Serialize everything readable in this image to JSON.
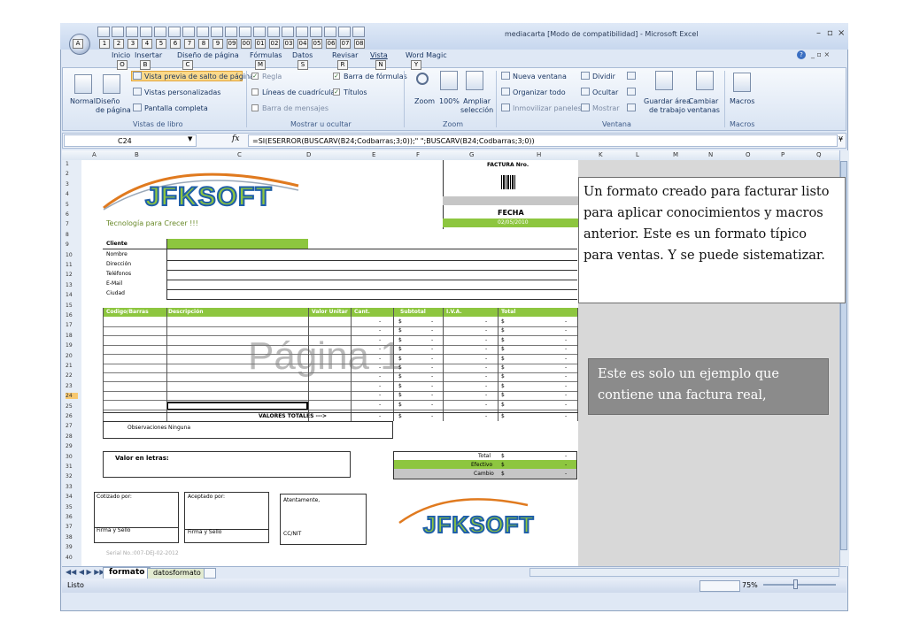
{
  "window": {
    "title": "mediacarta [Modo de compatibilidad] - Microsoft Excel",
    "qat_keytips": [
      "1",
      "2",
      "3",
      "4",
      "5",
      "6",
      "7",
      "8",
      "9",
      "09",
      "00",
      "01",
      "02",
      "03",
      "04",
      "05",
      "06",
      "07",
      "08"
    ],
    "controls": [
      "–",
      "▫",
      "×"
    ]
  },
  "tabs": [
    {
      "label": "Inicio",
      "key": "O"
    },
    {
      "label": "Insertar",
      "key": "B"
    },
    {
      "label": "Diseño de página",
      "key": "C"
    },
    {
      "label": "Fórmulas",
      "key": "M"
    },
    {
      "label": "Datos",
      "key": "S"
    },
    {
      "label": "Revisar",
      "key": "R"
    },
    {
      "label": "Vista",
      "key": "N"
    },
    {
      "label": "Word Magic",
      "key": "Y"
    }
  ],
  "ribbon": {
    "normal": "Normal",
    "diseno": "Diseño\nde página",
    "vista_previa": "Vista previa de salto de página",
    "vistas_personalizadas": "Vistas personalizadas",
    "pantalla_completa": "Pantalla completa",
    "group_vistas": "Vistas de libro",
    "regla": "Regla",
    "barra_formulas": "Barra de fórmulas",
    "lineas": "Líneas de cuadrícula",
    "titulos": "Títulos",
    "barra_mensajes": "Barra de mensajes",
    "group_mostrar": "Mostrar u ocultar",
    "zoom": "Zoom",
    "zoom100": "100%",
    "ampliar": "Ampliar\nselección",
    "group_zoom": "Zoom",
    "nueva_ventana": "Nueva ventana",
    "organizar": "Organizar todo",
    "inmovilizar": "Inmovilizar paneles",
    "dividir": "Dividir",
    "ocultar": "Ocultar",
    "mostrar": "Mostrar",
    "guardar_area": "Guardar área\nde trabajo",
    "cambiar_ventanas": "Cambiar\nventanas",
    "group_ventana": "Ventana",
    "macros": "Macros",
    "group_macros": "Macros"
  },
  "formula_bar": {
    "name_box": "C24",
    "fx": "fx",
    "formula": "=SI(ESERROR(BUSCARV(B24;Codbarras;3;0));\" \";BUSCARV(B24;Codbarras;3;0))"
  },
  "columns": [
    "A",
    "B",
    "C",
    "D",
    "E",
    "F",
    "G",
    "H",
    "K",
    "L",
    "M",
    "N",
    "O",
    "P",
    "Q"
  ],
  "rows": [
    "1",
    "2",
    "3",
    "4",
    "5",
    "6",
    "7",
    "8",
    "9",
    "10",
    "11",
    "12",
    "13",
    "14",
    "15",
    "16",
    "17",
    "18",
    "19",
    "20",
    "21",
    "22",
    "23",
    "24",
    "25",
    "26",
    "27",
    "28",
    "29",
    "30",
    "31",
    "32",
    "33",
    "34",
    "35",
    "36",
    "37",
    "38",
    "39",
    "40"
  ],
  "invoice": {
    "factura": "FACTURA Nro.",
    "fecha": "FECHA",
    "fecha_val": "02/05/2010",
    "logo": "JFKSOFT",
    "tagline": "Tecnología para Crecer !!!",
    "cliente": "Cliente",
    "fields": [
      "Nombre",
      "Dirección",
      "Teléfonos",
      "E-Mail",
      "Ciudad"
    ],
    "headers": [
      "Codigo/Barras",
      "Descripción",
      "Valor Unitar",
      "Cant.",
      "Subtotal",
      "I.V.A.",
      "Total"
    ],
    "dollar": "$",
    "dash": "-",
    "valores_totales": "VALORES TOTALES --->",
    "observaciones": "Observaciones",
    "ninguna": "Ninguna",
    "valor_letras": "Valor en letras:",
    "total": "Total",
    "efectivo": "Efectivo",
    "cambio": "Cambio",
    "cotizado": "Cotizado por:",
    "aceptado": "Aceptado por:",
    "atentamente": "Atentamente,",
    "firma1": "Firma y Sello",
    "firma2": "Firma y Sello",
    "ccnit": "CC/NIT",
    "serial": "Serial No.:007-DEJ-02-2012",
    "watermark": "Página 1"
  },
  "notes": {
    "note1": "Un formato creado para facturar listo para aplicar conocimientos y macros anterior.  Este es un formato típico para ventas.  Y se puede sistematizar.",
    "note2": "Este es solo un ejemplo que contiene una factura real,"
  },
  "sheet_tabs": [
    "formato",
    "datosformato"
  ],
  "status": {
    "ready": "Listo",
    "zoom": "75%"
  }
}
